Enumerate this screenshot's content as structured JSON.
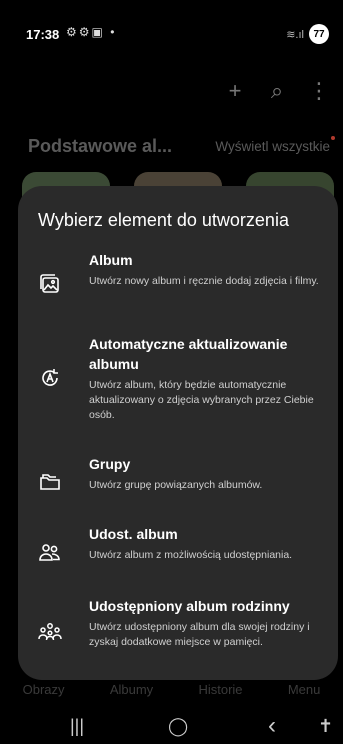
{
  "status_bar": {
    "time": "17:38",
    "left_icons": "⚙⚙▣ •",
    "signal": "≋.ıl",
    "battery": "77"
  },
  "toolbar": {
    "add_icon": "+",
    "search_icon": "⌕",
    "more_icon": "⋮"
  },
  "section": {
    "title": "Podstawowe al...",
    "see_all": "Wyświetl wszystkie"
  },
  "bottom_tabs": [
    "Obrazy",
    "Albumy",
    "Historie",
    "Menu"
  ],
  "sheet": {
    "title": "Wybierz element do utworzenia",
    "options": [
      {
        "icon": "album-icon",
        "title": "Album",
        "description": "Utwórz nowy album i ręcznie dodaj zdjęcia i filmy."
      },
      {
        "icon": "auto-update-icon",
        "title": "Automatyczne aktualizowanie albumu",
        "description": "Utwórz album, który będzie automatycznie aktualizowany o zdjęcia wybranych przez Ciebie osób."
      },
      {
        "icon": "folder-icon",
        "title": "Grupy",
        "description": "Utwórz grupę powiązanych albumów."
      },
      {
        "icon": "shared-album-icon",
        "title": "Udost. album",
        "description": "Utwórz album z możliwością udostępniania."
      },
      {
        "icon": "family-album-icon",
        "title": "Udostępniony album rodzinny",
        "description": "Utwórz udostępniony album dla swojej rodziny i zyskaj dodatkowe miejsce w pamięci."
      }
    ]
  },
  "nav_bar": {
    "recents": "|||",
    "home": "◯",
    "back": "‹",
    "accessibility": "✝"
  }
}
